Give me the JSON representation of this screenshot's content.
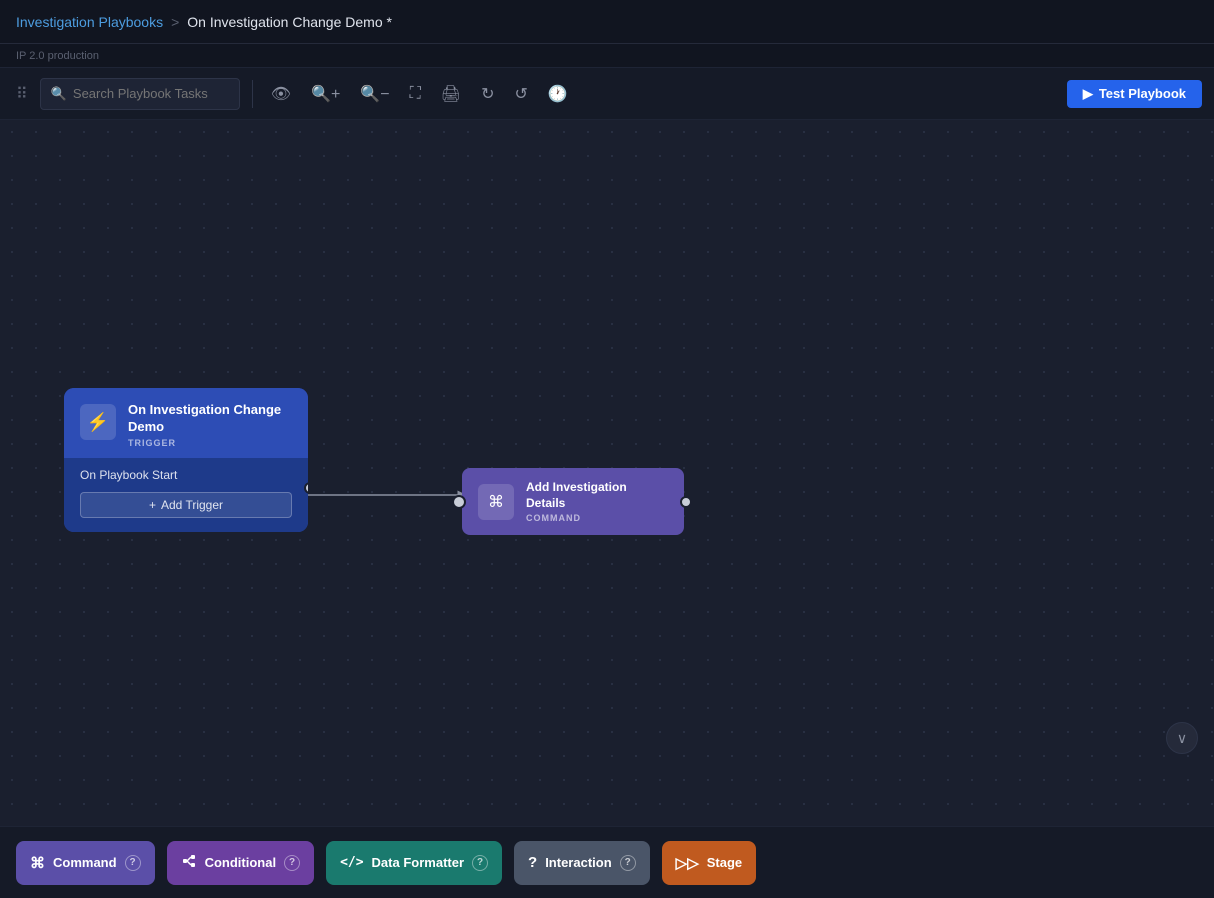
{
  "nav": {
    "breadcrumb_link": "Investigation Playbooks",
    "separator": ">",
    "current_page": "On Investigation Change Demo *"
  },
  "sub_info": {
    "text": "IP 2.0 production"
  },
  "toolbar": {
    "search_placeholder": "Search Playbook Tasks",
    "test_playbook_label": "Test Playbook",
    "test_playbook_icon": "▶"
  },
  "trigger_node": {
    "title": "On Investigation Change Demo",
    "badge": "TRIGGER",
    "body_label": "On Playbook Start",
    "add_trigger_label": "Add Trigger",
    "add_trigger_icon": "+"
  },
  "command_node": {
    "title": "Add Investigation Details",
    "badge": "COMMAND"
  },
  "bottom_chips": [
    {
      "id": "command",
      "label": "Command",
      "icon": "⌘",
      "color": "command"
    },
    {
      "id": "conditional",
      "label": "Conditional",
      "icon": "⊣",
      "color": "conditional"
    },
    {
      "id": "data-formatter",
      "label": "Data Formatter",
      "icon": "</>",
      "color": "data-formatter"
    },
    {
      "id": "interaction",
      "label": "Interaction",
      "icon": "?",
      "color": "interaction"
    },
    {
      "id": "stage",
      "label": "Stage",
      "icon": "▷▷",
      "color": "stage"
    }
  ],
  "bottom_toggle": {
    "icon": "∨"
  }
}
